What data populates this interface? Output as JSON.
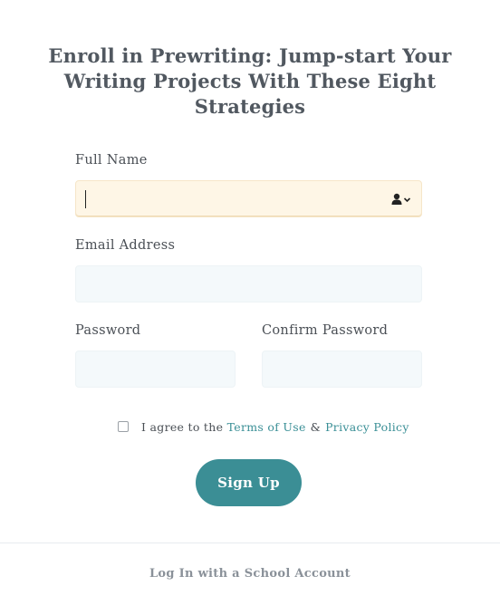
{
  "form": {
    "title": "Enroll in Prewriting: Jump-start Your Writing Projects With These Eight Strategies",
    "full_name_label": "Full Name",
    "full_name_value": "",
    "email_label": "Email Address",
    "email_value": "",
    "password_label": "Password",
    "confirm_password_label": "Confirm Password",
    "agree_prefix": "I agree to the",
    "terms_link": "Terms of Use",
    "and_text": "&",
    "privacy_link": "Privacy Policy",
    "signup_button": "Sign Up",
    "school_login_link": "Log In with a School Account"
  },
  "icons": {
    "autofill": "contact-autofill-icon"
  },
  "colors": {
    "accent": "#3b8e95",
    "link": "#3a8f96",
    "active_field_bg": "#fef6e6",
    "field_bg": "#f4f9fb"
  }
}
